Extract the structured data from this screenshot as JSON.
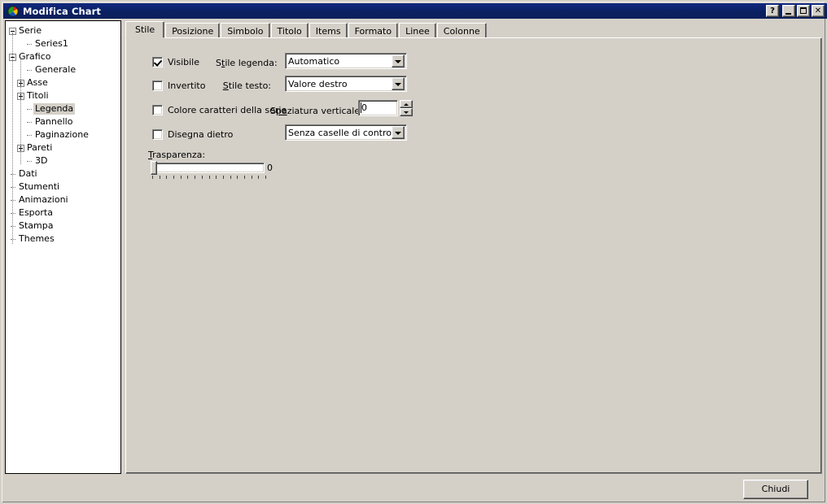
{
  "window": {
    "title": "Modifica Chart",
    "icon": "chart-pie-icon",
    "titlebar_color": "#0a2060",
    "face_color": "#d4d0c8",
    "buttons": {
      "help": "?",
      "minimize": "minimize-icon",
      "maximize": "maximize-icon",
      "close": "✕"
    }
  },
  "tree": {
    "selected": "Legenda",
    "nodes": [
      {
        "label": "Serie",
        "depth": 0,
        "toggle": "minus"
      },
      {
        "label": "Series1",
        "depth": 2,
        "toggle": "leaf"
      },
      {
        "label": "Grafico",
        "depth": 0,
        "toggle": "minus"
      },
      {
        "label": "Generale",
        "depth": 2,
        "toggle": "leaf"
      },
      {
        "label": "Asse",
        "depth": 1,
        "toggle": "plus"
      },
      {
        "label": "Titoli",
        "depth": 1,
        "toggle": "plus"
      },
      {
        "label": "Legenda",
        "depth": 2,
        "toggle": "leaf"
      },
      {
        "label": "Pannello",
        "depth": 2,
        "toggle": "leaf"
      },
      {
        "label": "Paginazione",
        "depth": 2,
        "toggle": "leaf"
      },
      {
        "label": "Pareti",
        "depth": 1,
        "toggle": "plus"
      },
      {
        "label": "3D",
        "depth": 2,
        "toggle": "leaf"
      },
      {
        "label": "Dati",
        "depth": 0,
        "toggle": "leaf"
      },
      {
        "label": "Stumenti",
        "depth": 0,
        "toggle": "leaf"
      },
      {
        "label": "Animazioni",
        "depth": 0,
        "toggle": "leaf"
      },
      {
        "label": "Esporta",
        "depth": 0,
        "toggle": "leaf"
      },
      {
        "label": "Stampa",
        "depth": 0,
        "toggle": "leaf"
      },
      {
        "label": "Themes",
        "depth": 0,
        "toggle": "leaf"
      }
    ]
  },
  "tabs": {
    "active": "Stile",
    "items": [
      {
        "label": "Stile"
      },
      {
        "label": "Posizione"
      },
      {
        "label": "Simbolo"
      },
      {
        "label": "Titolo"
      },
      {
        "label": "Items"
      },
      {
        "label": "Formato"
      },
      {
        "label": "Linee"
      },
      {
        "label": "Colonne"
      }
    ]
  },
  "form": {
    "checkboxes": [
      {
        "label": "Visibile",
        "checked": true
      },
      {
        "label": "Invertito",
        "checked": false
      },
      {
        "label": "Colore caratteri della serie",
        "checked": false
      },
      {
        "label": "Disegna dietro",
        "checked": false
      }
    ],
    "legend_style": {
      "label": "Stile legenda:",
      "label_accel": "ti",
      "value": "Automatico"
    },
    "text_style": {
      "label": "Stile testo:",
      "label_accel": "S",
      "value": "Valore destro"
    },
    "vertical_spacing": {
      "label": "Spaziatura verticale:",
      "label_accel": "pa",
      "value": "0"
    },
    "checkbox_style": {
      "value": "Senza caselle di controllo"
    },
    "transparency": {
      "label": "Trasparenza:",
      "label_accel": "T",
      "value": "0",
      "min": 0,
      "max": 100,
      "tick_count": 17
    }
  },
  "footer": {
    "close_label": "Chiudi"
  }
}
